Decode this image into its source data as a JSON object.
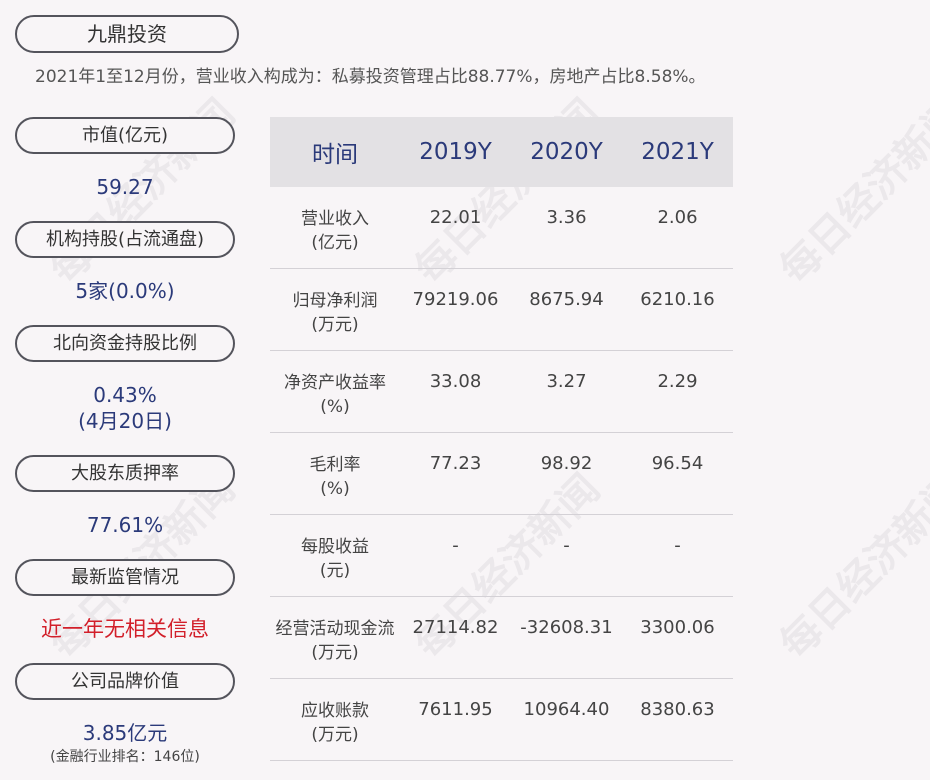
{
  "company": "九鼎投资",
  "summary": "2021年1至12月份，营业收入构成为：私募投资管理占比88.77%，房地产占比8.58%。",
  "watermark": "每日经济新闻",
  "sidebar": {
    "market_cap": {
      "label": "市值(亿元)",
      "value": "59.27"
    },
    "institution": {
      "label": "机构持股(占流通盘)",
      "value": "5家(0.0%)"
    },
    "northbound": {
      "label": "北向资金持股比例",
      "value": "0.43%",
      "date": "(4月20日)"
    },
    "pledge": {
      "label": "大股东质押率",
      "value": "77.61%"
    },
    "regulation": {
      "label": "最新监管情况",
      "value": "近一年无相关信息"
    },
    "brand": {
      "label": "公司品牌价值",
      "value": "3.85亿元",
      "rank": "(金融行业排名：146位)"
    }
  },
  "table": {
    "headers": [
      "时间",
      "2019Y",
      "2020Y",
      "2021Y"
    ],
    "rows": [
      {
        "label": "营业收入",
        "unit": "(亿元)",
        "values": [
          "22.01",
          "3.36",
          "2.06"
        ]
      },
      {
        "label": "归母净利润",
        "unit": "(万元)",
        "values": [
          "79219.06",
          "8675.94",
          "6210.16"
        ]
      },
      {
        "label": "净资产收益率",
        "unit": "(%)",
        "values": [
          "33.08",
          "3.27",
          "2.29"
        ]
      },
      {
        "label": "毛利率",
        "unit": "(%)",
        "values": [
          "77.23",
          "98.92",
          "96.54"
        ]
      },
      {
        "label": "每股收益",
        "unit": "(元)",
        "values": [
          "-",
          "-",
          "-"
        ]
      },
      {
        "label": "经营活动现金流",
        "unit": "(万元)",
        "values": [
          "27114.82",
          "-32608.31",
          "3300.06"
        ]
      },
      {
        "label": "应收账款",
        "unit": "(万元)",
        "values": [
          "7611.95",
          "10964.40",
          "8380.63"
        ]
      }
    ]
  }
}
